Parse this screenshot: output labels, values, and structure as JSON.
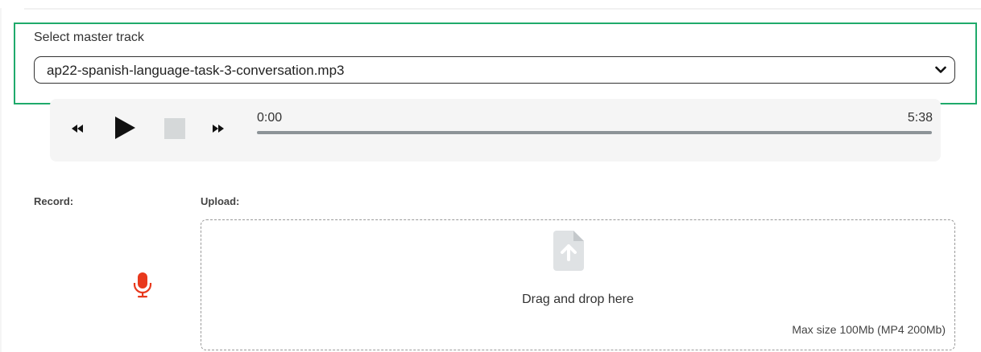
{
  "master_track": {
    "label": "Select master track",
    "selected_value": "ap22-spanish-language-task-3-conversation.mp3",
    "highlight_color": "#1faa6b"
  },
  "player": {
    "current_time": "0:00",
    "total_time": "5:38",
    "progress_fraction": 0,
    "buttons": [
      "rewind-icon",
      "play-icon",
      "stop-icon",
      "fast-forward-icon"
    ]
  },
  "record": {
    "label": "Record:",
    "icon": "microphone-icon",
    "icon_color": "#e8391d"
  },
  "upload": {
    "label": "Upload:",
    "icon": "file-upload-icon",
    "drop_text": "Drag and drop here",
    "max_size_text": "Max size 100Mb (MP4 200Mb)"
  }
}
